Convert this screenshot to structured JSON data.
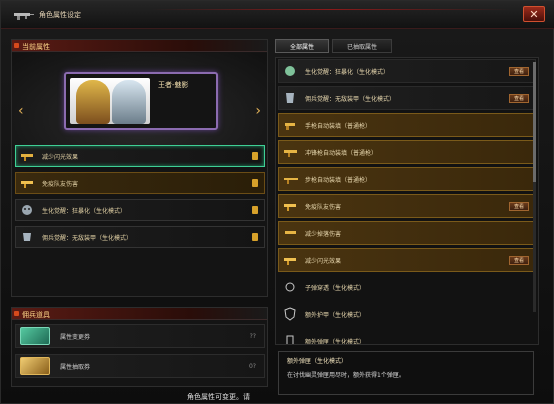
{
  "window": {
    "title": "角色属性设定",
    "close_label": "✕"
  },
  "left_panel": {
    "header": "当前属性",
    "character": {
      "name": "王者-魅影",
      "prev": "‹",
      "next": "›"
    },
    "attributes": [
      {
        "label": "减少闪光效果",
        "icon": "flash-gun-icon",
        "selected": true,
        "gold": false
      },
      {
        "label": "免疫队友伤害",
        "icon": "gun-gold-icon",
        "selected": false,
        "gold": true
      },
      {
        "label": "生化觉醒：狂暴化（生化模式）",
        "icon": "zombie-icon",
        "selected": false,
        "gold": false
      },
      {
        "label": "佣兵觉醒：无敌装甲（生化模式）",
        "icon": "armor-icon",
        "selected": false,
        "gold": false
      }
    ]
  },
  "bottom_panel": {
    "header": "佣兵道具",
    "cards": [
      {
        "label": "属性变更券",
        "icon": "ticket-green-icon",
        "qty": "??"
      },
      {
        "label": "属性抽取券",
        "icon": "ticket-gold-icon",
        "qty": "0?"
      }
    ]
  },
  "footer_text": "角色属性可变更。请",
  "right_panel": {
    "tabs": [
      {
        "label": "全部属性",
        "active": true
      },
      {
        "label": "已抽取属性",
        "active": false
      }
    ],
    "properties": [
      {
        "label": "生化觉醒：狂暴化（生化模式）",
        "icon": "zombie-icon",
        "style": "normal",
        "button": "查看"
      },
      {
        "label": "佣兵觉醒：无敌装甲（生化模式）",
        "icon": "armor-icon",
        "style": "normal",
        "button": "查看"
      },
      {
        "label": "手枪自动装填（普通枪）",
        "icon": "pistol-icon",
        "style": "gold",
        "button": ""
      },
      {
        "label": "冲锋枪自动装填（普通枪）",
        "icon": "smg-icon",
        "style": "gold",
        "button": ""
      },
      {
        "label": "步枪自动装填（普通枪）",
        "icon": "rifle-icon",
        "style": "gold",
        "button": ""
      },
      {
        "label": "免疫队友伤害",
        "icon": "gun-gold-icon",
        "style": "gold",
        "button": "查看"
      },
      {
        "label": "减少掉落伤害",
        "icon": "fall-icon",
        "style": "gold",
        "button": ""
      },
      {
        "label": "减少闪光效果",
        "icon": "flash-gun-icon",
        "style": "gold",
        "button": "查看"
      },
      {
        "label": "子弹穿透（生化模式）",
        "icon": "bullet-icon",
        "style": "dim",
        "button": ""
      },
      {
        "label": "额外护甲（生化模式）",
        "icon": "shield-icon",
        "style": "dim",
        "button": ""
      },
      {
        "label": "额外弹匣（生化模式）",
        "icon": "magazine-icon",
        "style": "dim",
        "button": ""
      }
    ],
    "tooltip": {
      "title": "额外弹匣（生化模式）",
      "desc": "在讨伐幽灵弹匣用尽时，额外获得1个弹匣。"
    }
  },
  "colors": {
    "accent": "#d7a12a",
    "selected": "#3fcf95",
    "header": "#5a1b14"
  }
}
